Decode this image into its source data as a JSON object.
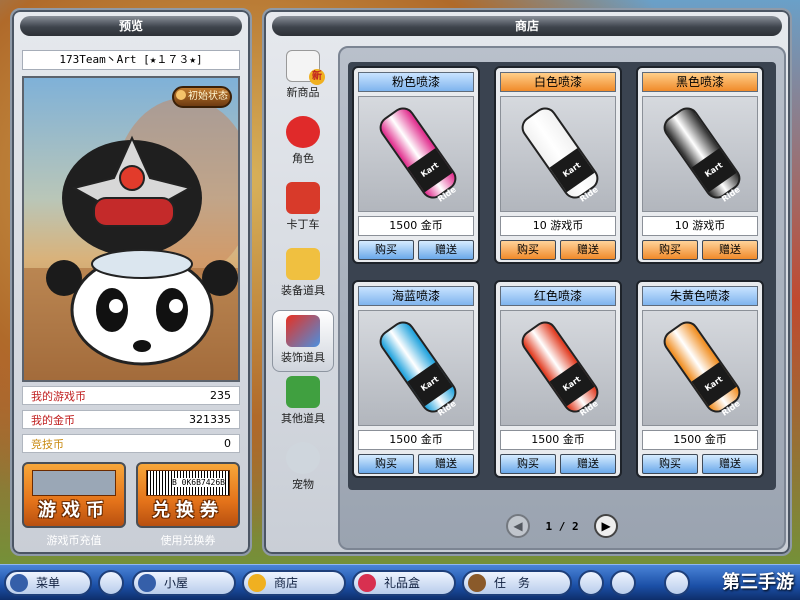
{
  "preview": {
    "title": "预览",
    "player_name": "173Team丶Art [★１７３★]",
    "reset_label": "初始状态",
    "stats": [
      {
        "label": "我的游戏币",
        "value": "235"
      },
      {
        "label": "我的金币",
        "value": "321335"
      },
      {
        "label": "竞技币",
        "value": "0"
      }
    ],
    "buttons": [
      {
        "text": "游戏币",
        "caption": "游戏币充值"
      },
      {
        "text": "兑换券",
        "caption": "使用兑换券",
        "barcode": "B 0K6B7426B"
      }
    ]
  },
  "shop": {
    "title": "商店",
    "categories": [
      {
        "label": "新商品",
        "icon": "new-icon",
        "badge": "新"
      },
      {
        "label": "角色",
        "icon": "character-icon"
      },
      {
        "label": "卡丁车",
        "icon": "kart-icon"
      },
      {
        "label": "装备道具",
        "icon": "equipment-icon"
      },
      {
        "label": "装饰道具",
        "icon": "decoration-icon",
        "active": true
      },
      {
        "label": "其他道具",
        "icon": "other-items-icon"
      },
      {
        "label": "宠物",
        "icon": "pet-icon"
      }
    ],
    "items": [
      {
        "name": "粉色喷漆",
        "price": "1500 金币",
        "buy": "购买",
        "gift": "赠送",
        "theme": "blue",
        "color": "#e0288a",
        "can_text": "Kart Ride Pain"
      },
      {
        "name": "白色喷漆",
        "price": "10 游戏币",
        "buy": "购买",
        "gift": "赠送",
        "theme": "orange",
        "color": "#f2f2f2",
        "can_text": "Kart Ride Pain"
      },
      {
        "name": "黑色喷漆",
        "price": "10 游戏币",
        "buy": "购买",
        "gift": "赠送",
        "theme": "orange",
        "color": "#2a2a2a",
        "can_text": "Kart Ride Pain"
      },
      {
        "name": "海蓝喷漆",
        "price": "1500 金币",
        "buy": "购买",
        "gift": "赠送",
        "theme": "blue",
        "color": "#1aa0dc",
        "can_text": "Kart Ride Pain"
      },
      {
        "name": "红色喷漆",
        "price": "1500 金币",
        "buy": "购买",
        "gift": "赠送",
        "theme": "blue",
        "color": "#e03418",
        "can_text": "Kart Ride Pain"
      },
      {
        "name": "朱黄色喷漆",
        "price": "1500 金币",
        "buy": "购买",
        "gift": "赠送",
        "theme": "blue",
        "color": "#f08a1a",
        "can_text": "Kart Ride Pain"
      }
    ],
    "pager": {
      "current": "1",
      "separator": "/",
      "total": "2",
      "prev_icon": "prev-arrow-icon",
      "next_icon": "next-arrow-icon"
    }
  },
  "taskbar": {
    "menu": "菜单",
    "house": "小屋",
    "shop": "商店",
    "giftbox": "礼品盒",
    "tasks": "任　务",
    "watermark": "第三手游"
  }
}
